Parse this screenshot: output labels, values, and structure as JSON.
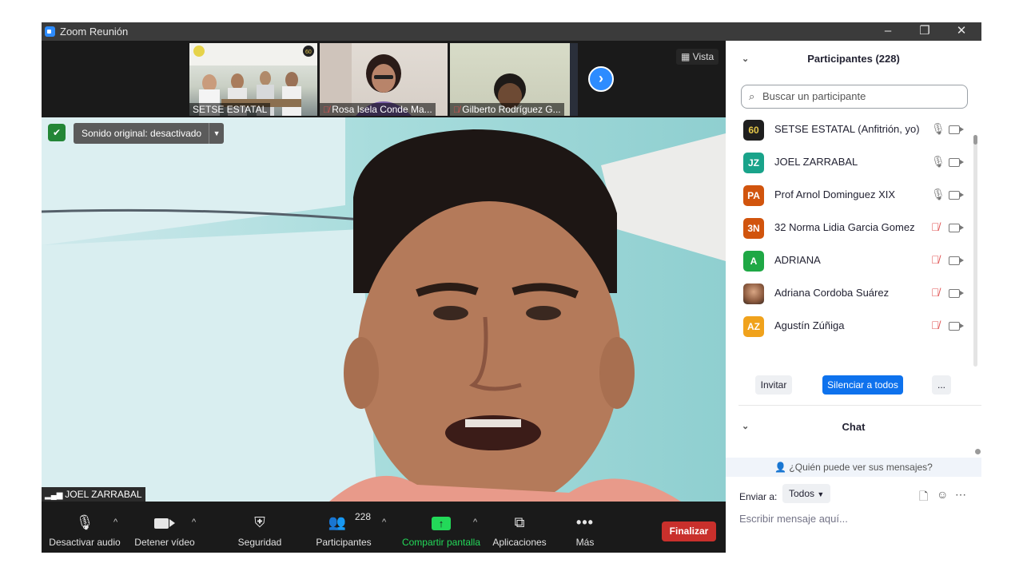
{
  "window": {
    "title": "Zoom Reunión",
    "controls": [
      "–",
      "❐",
      "✕"
    ]
  },
  "thumbnails": [
    {
      "label": "SETSE ESTATAL",
      "muted": false
    },
    {
      "label": "Rosa Isela Conde Ma...",
      "muted": true
    },
    {
      "label": "Gilberto Rodríguez G...",
      "muted": true
    }
  ],
  "view": {
    "label": "Vista"
  },
  "video": {
    "original_sound": "Sonido original: desactivado",
    "speaker_name": "JOEL ZARRABAL"
  },
  "toolbar": {
    "mute_label": "Desactivar audio",
    "video_label": "Detener vídeo",
    "security_label": "Seguridad",
    "participants_label": "Participantes",
    "participants_count": "228",
    "share_label": "Compartir pantalla",
    "apps_label": "Aplicaciones",
    "more_label": "Más",
    "end_label": "Finalizar",
    "share_color": "#23d959",
    "end_color": "#c9302c"
  },
  "participants_panel": {
    "title": "Participantes (228)",
    "search_placeholder": "Buscar un participante",
    "participants": [
      {
        "initials": "60",
        "name": "SETSE ESTATAL (Anfitrión, yo)",
        "color": "#1f1f1f",
        "mic_muted": false
      },
      {
        "initials": "JZ",
        "name": "JOEL ZARRABAL",
        "color": "#19a38a",
        "mic_muted": false
      },
      {
        "initials": "PA",
        "name": "Prof Arnol Dominguez XIX",
        "color": "#d1540d",
        "mic_muted": false
      },
      {
        "initials": "3N",
        "name": "32 Norma Lidia Garcia Gomez",
        "color": "#d1540d",
        "mic_muted": true
      },
      {
        "initials": "A",
        "name": "ADRIANA",
        "color": "#1fa845",
        "mic_muted": true
      },
      {
        "initials": "",
        "name": "Adriana Cordoba Suárez",
        "color": "#b07a5a",
        "mic_muted": true
      },
      {
        "initials": "AZ",
        "name": "Agustín Zúñiga",
        "color": "#f0a21c",
        "mic_muted": true
      }
    ],
    "invite_label": "Invitar",
    "mute_all_label": "Silenciar a todos",
    "more_label": "..."
  },
  "chat": {
    "title": "Chat",
    "who_can_see": "¿Quién puede ver sus mensajes?",
    "send_to_label": "Enviar a:",
    "recipient": "Todos",
    "placeholder": "Escribir mensaje aquí..."
  }
}
